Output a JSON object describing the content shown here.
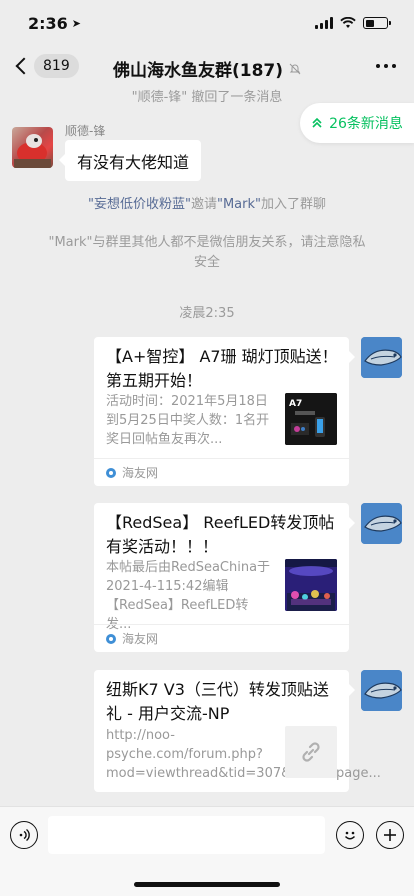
{
  "status_bar": {
    "time": "2:36"
  },
  "nav": {
    "unread_count": "819",
    "title": "佛山海水鱼友群(187)"
  },
  "system_top": {
    "name": "\"顺德-锋\"",
    "text": " 撤回了一条消息"
  },
  "new_messages": {
    "label": "26条新消息"
  },
  "message_left": {
    "sender": "顺德-锋",
    "text": "有没有大佬知道"
  },
  "system_invite": {
    "inviter": "\"妄想低价收粉蓝\"",
    "action": "邀请",
    "invitee": "\"Mark\"",
    "suffix": "加入了群聊"
  },
  "system_notice": {
    "line1": "\"Mark\"与群里其他人都不是微信朋友关系，请注意隐私",
    "line2": "安全"
  },
  "timestamp": "凌晨2:35",
  "cards": [
    {
      "title": "【A+智控】 A7珊 瑚灯顶贴送！第五期开始！",
      "description": "活动时间：2021年5月18日到5月25日中奖人数：1名开奖日回帖鱼友再次...",
      "source": "海友网",
      "thumb_label": "A7"
    },
    {
      "title": "【RedSea】 ReefLED转发顶帖有奖活动！！！",
      "description": "本帖最后由RedSeaChina于2021-4-115:42编辑【RedSea】ReefLED转发...",
      "source": "海友网"
    },
    {
      "title": "纽斯K7 V3（三代）转发顶贴送礼 - 用户交流-NP",
      "description": "http://noo-psyche.com/forum.php?mod=viewthread&tid=307&extra=page..."
    }
  ],
  "colors": {
    "accent_green": "#07c160",
    "link_blue": "#576b95",
    "background": "#ededed"
  }
}
